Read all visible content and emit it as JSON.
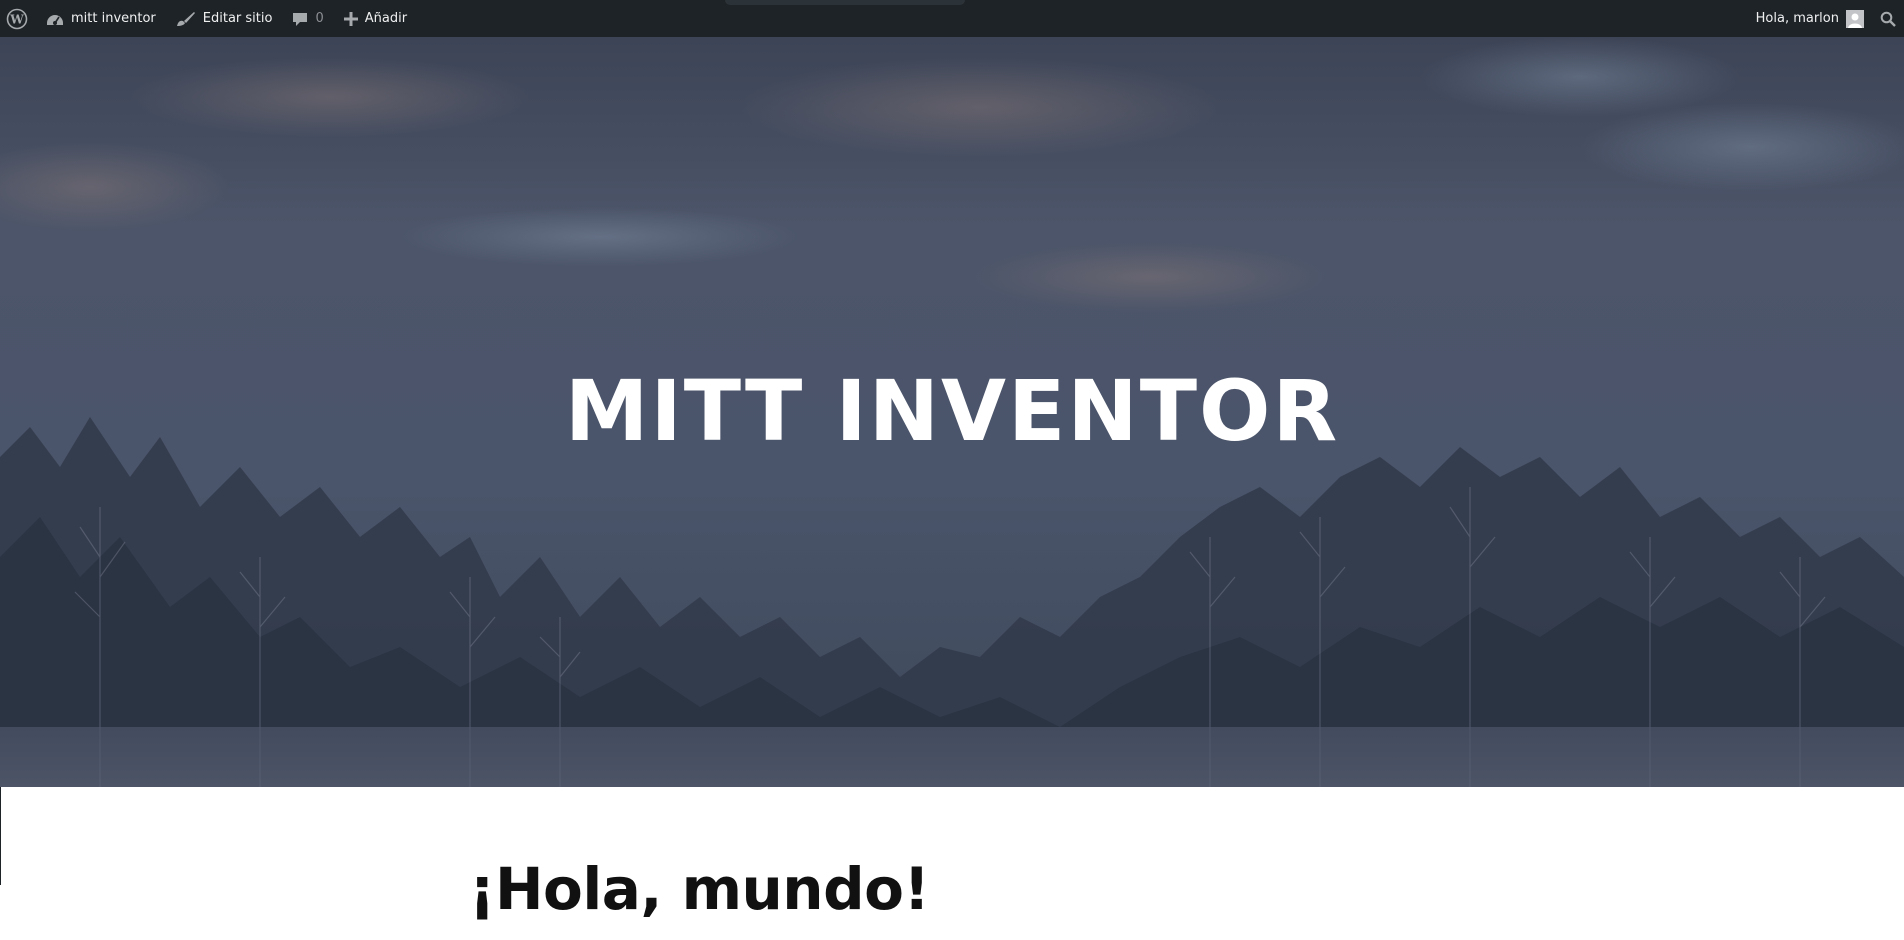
{
  "admin_bar": {
    "wp_logo_icon": "wordpress-icon",
    "site_name": "mitt inventor",
    "site_icon": "dashboard-icon",
    "edit_site_label": "Editar sitio",
    "edit_icon": "brush-icon",
    "comments_icon": "comment-icon",
    "comments_count": "0",
    "add_label": "Añadir",
    "add_icon": "plus-icon",
    "greeting": "Hola, marlon",
    "avatar_icon": "user-avatar-icon",
    "search_icon": "search-icon",
    "background_color": "#1d2327"
  },
  "hero": {
    "site_title": "MITT INVENTOR",
    "overlay_color": "#404a5c"
  },
  "post": {
    "title": "¡Hola, mundo!"
  }
}
